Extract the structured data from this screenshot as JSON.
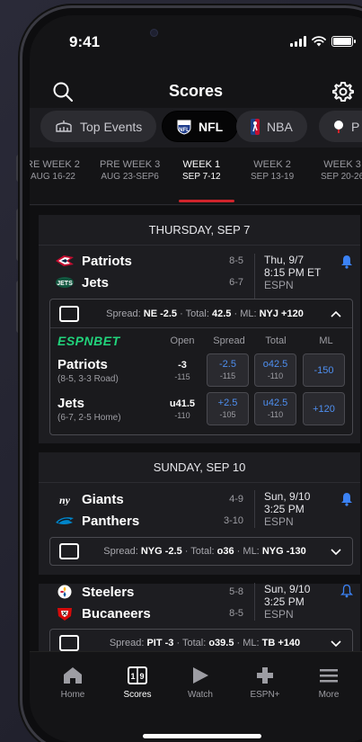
{
  "status": {
    "time": "9:41"
  },
  "header": {
    "title": "Scores"
  },
  "leagues": [
    {
      "label": "Top Events"
    },
    {
      "label": "NFL"
    },
    {
      "label": "NBA"
    },
    {
      "label": "P"
    }
  ],
  "weeks": [
    {
      "label": "RE WEEK 2",
      "range": "AUG 16-22"
    },
    {
      "label": "PRE WEEK 3",
      "range": "AUG 23-SEP6"
    },
    {
      "label": "WEEK 1",
      "range": "SEP 7-12"
    },
    {
      "label": "WEEK 2",
      "range": "SEP 13-19"
    },
    {
      "label": "WEEK 3",
      "range": "SEP 20-26"
    }
  ],
  "sections": [
    {
      "day": "THURSDAY, SEP 7",
      "game": {
        "away": {
          "name": "Patriots",
          "record": "8-5"
        },
        "home": {
          "name": "Jets",
          "record": "6-7"
        },
        "date": "Thu, 9/7",
        "time": "8:15 PM ET",
        "network": "ESPN",
        "odds": {
          "spread_label": "Spread:",
          "spread": "NE -2.5",
          "total_label": "Total:",
          "total": "42.5",
          "ml_label": "ML:",
          "ml": "NYJ +120"
        },
        "betting": {
          "brand": "ESPNBET",
          "columns": [
            "Open",
            "Spread",
            "Total",
            "ML"
          ],
          "rows": [
            {
              "team": "Patriots",
              "record": "(8-5, 3-3 Road)",
              "open": "-3",
              "open_juice": "-115",
              "spread": "-2.5",
              "spread_juice": "-115",
              "total": "o42.5",
              "total_juice": "-110",
              "ml": "-150"
            },
            {
              "team": "Jets",
              "record": "(6-7, 2-5 Home)",
              "open": "u41.5",
              "open_juice": "-110",
              "spread": "+2.5",
              "spread_juice": "-105",
              "total": "u42.5",
              "total_juice": "-110",
              "ml": "+120"
            }
          ]
        }
      }
    },
    {
      "day": "SUNDAY, SEP 10",
      "games": [
        {
          "away": {
            "name": "Giants",
            "record": "4-9"
          },
          "home": {
            "name": "Panthers",
            "record": "3-10"
          },
          "date": "Sun, 9/10",
          "time": "3:25 PM",
          "network": "ESPN",
          "odds": {
            "spread_label": "Spread:",
            "spread": "NYG -2.5",
            "total_label": "Total:",
            "total": "o36",
            "ml_label": "ML:",
            "ml": "NYG -130"
          }
        },
        {
          "away": {
            "name": "Steelers",
            "record": "5-8"
          },
          "home": {
            "name": "Bucaneers",
            "record": "8-5"
          },
          "date": "Sun, 9/10",
          "time": "3:25 PM",
          "network": "ESPN",
          "odds": {
            "spread_label": "Spread:",
            "spread": "PIT -3",
            "total_label": "Total:",
            "total": "o39.5",
            "ml_label": "ML:",
            "ml": "TB +140"
          }
        }
      ]
    }
  ],
  "tabs": [
    {
      "label": "Home"
    },
    {
      "label": "Scores"
    },
    {
      "label": "Watch"
    },
    {
      "label": "ESPN+"
    },
    {
      "label": "More"
    }
  ],
  "colors": {
    "accent": "#d0242b",
    "odds_blue": "#4e8ff0",
    "espnbet_green": "#21d47c",
    "bell_blue": "#3b82f6"
  }
}
